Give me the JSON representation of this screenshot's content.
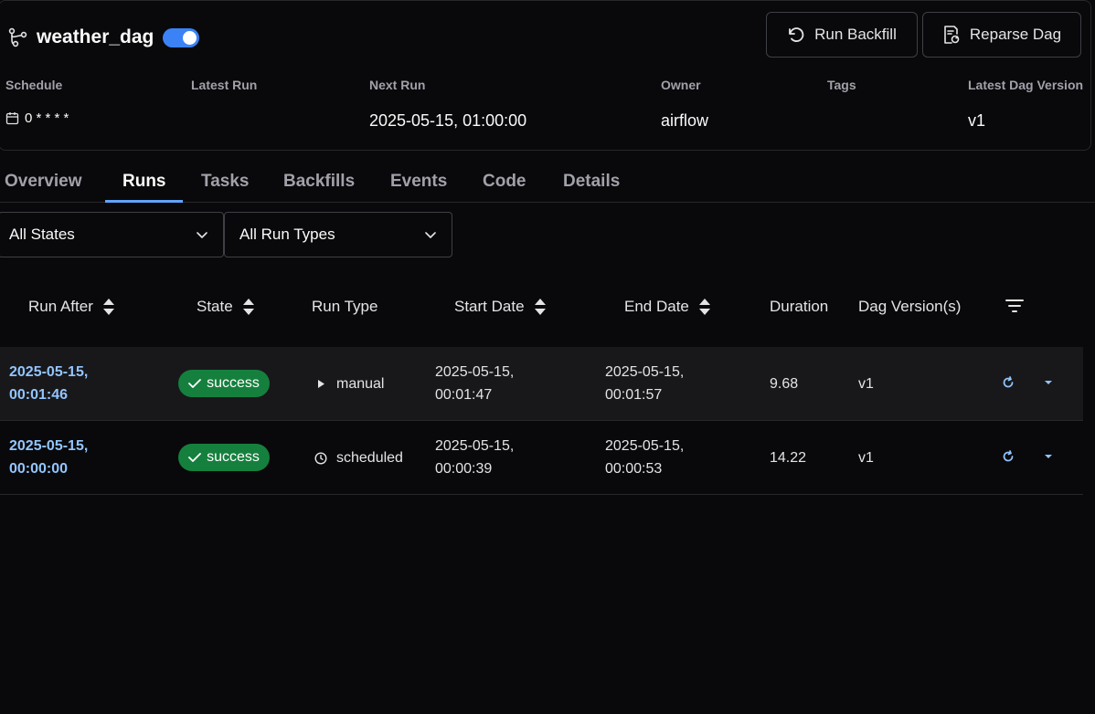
{
  "header": {
    "dag_id": "weather_dag",
    "paused_toggle_on": true,
    "run_backfill_label": "Run Backfill",
    "reparse_label": "Reparse Dag"
  },
  "meta": {
    "schedule_label": "Schedule",
    "schedule_value": "0 * * * *",
    "latest_run_label": "Latest Run",
    "latest_run_value": "",
    "next_run_label": "Next Run",
    "next_run_value": "2025-05-15, 01:00:00",
    "owner_label": "Owner",
    "owner_value": "airflow",
    "tags_label": "Tags",
    "tags_value": "",
    "latest_version_label": "Latest Dag Version",
    "latest_version_value": "v1"
  },
  "tabs": [
    {
      "label": "Overview",
      "active": false
    },
    {
      "label": "Runs",
      "active": true
    },
    {
      "label": "Tasks",
      "active": false
    },
    {
      "label": "Backfills",
      "active": false
    },
    {
      "label": "Events",
      "active": false
    },
    {
      "label": "Code",
      "active": false
    },
    {
      "label": "Details",
      "active": false
    }
  ],
  "filters": {
    "state_selected": "All States",
    "run_type_selected": "All Run Types"
  },
  "table": {
    "columns": {
      "run_after": "Run After",
      "state": "State",
      "run_type": "Run Type",
      "start_date": "Start Date",
      "end_date": "End Date",
      "duration": "Duration",
      "dag_versions": "Dag Version(s)"
    },
    "rows": [
      {
        "run_after_date": "2025-05-15,",
        "run_after_time": "00:01:46",
        "state": "success",
        "run_type": "manual",
        "start_date": "2025-05-15,",
        "start_time": "00:01:47",
        "end_date": "2025-05-15,",
        "end_time": "00:01:57",
        "duration": "9.68",
        "dag_version": "v1"
      },
      {
        "run_after_date": "2025-05-15,",
        "run_after_time": "00:00:00",
        "state": "success",
        "run_type": "scheduled",
        "start_date": "2025-05-15,",
        "start_time": "00:00:39",
        "end_date": "2025-05-15,",
        "end_time": "00:00:53",
        "duration": "14.22",
        "dag_version": "v1"
      }
    ]
  },
  "colors": {
    "background": "#09090b",
    "accent": "#3b82f6",
    "link": "#93c5fd",
    "success": "#15803d"
  }
}
